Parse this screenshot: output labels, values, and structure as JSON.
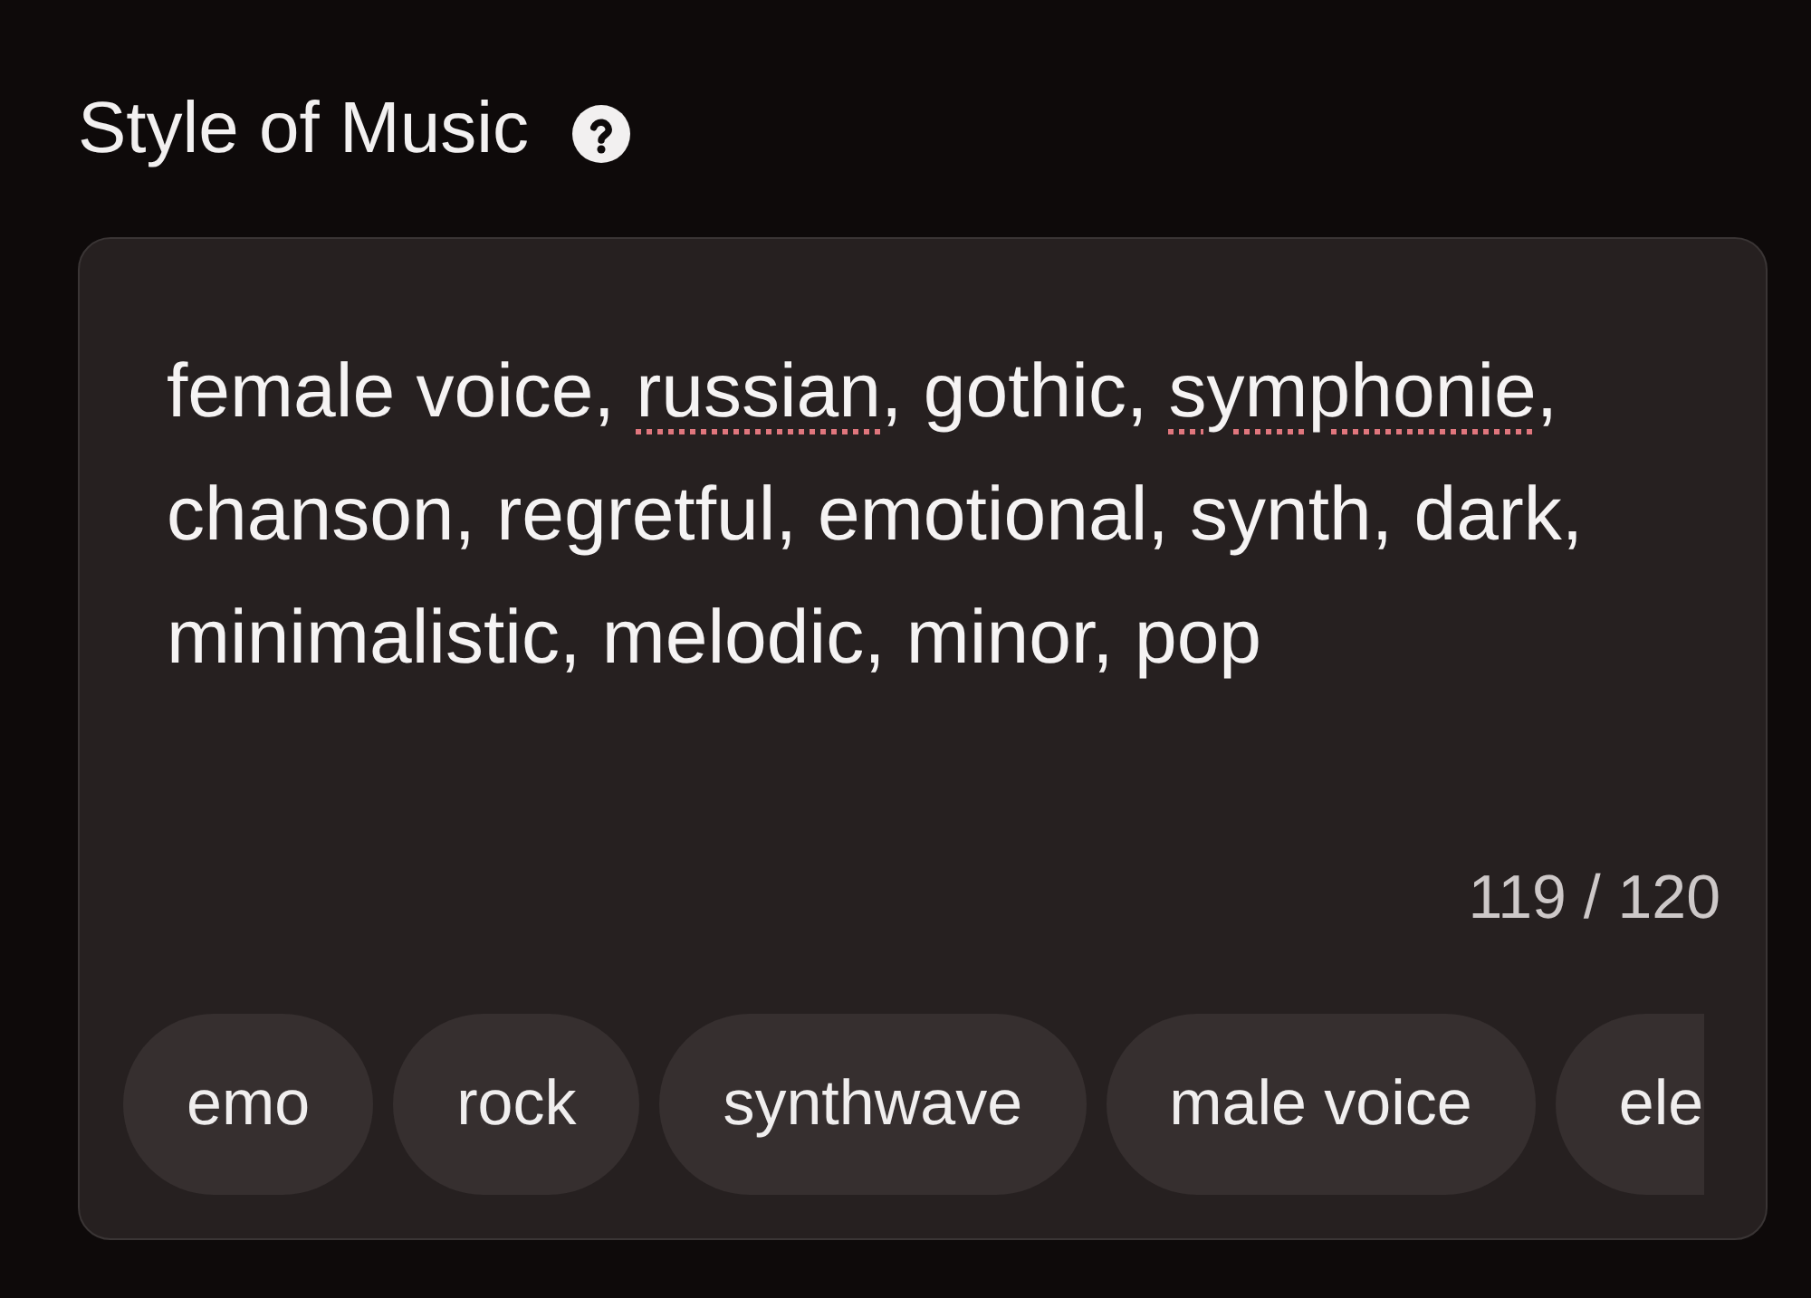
{
  "style_field": {
    "label": "Style of Music",
    "value": [
      {
        "text": "female voice, ",
        "misspelled": false
      },
      {
        "text": "russian",
        "misspelled": true
      },
      {
        "text": ", gothic, ",
        "misspelled": false
      },
      {
        "text": "symphonie",
        "misspelled": true
      },
      {
        "text": ", chanson, regretful, emotional, synth, dark, minimalistic, melodic, minor, pop",
        "misspelled": false
      }
    ],
    "counter": "119 / 120",
    "suggestions": [
      "emo",
      "rock",
      "synthwave",
      "male voice",
      "ele"
    ]
  }
}
